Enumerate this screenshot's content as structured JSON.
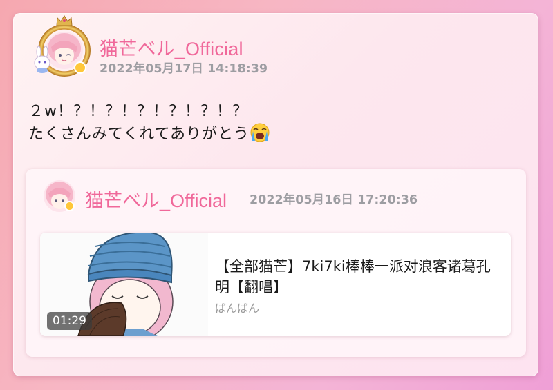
{
  "post": {
    "username": "猫芒ベル_Official",
    "timestamp": "2022年05月17日 14:18:39",
    "text_line1": "２w！？！？！？！？！？！？",
    "text_line2": "たくさんみてくれてありがとう",
    "emoji": "crying-face"
  },
  "repost": {
    "username": "猫芒ベル_Official",
    "timestamp": "2022年05月16日 17:20:36",
    "video": {
      "duration": "01:29",
      "title": "【全部猫芒】7ki7ki棒棒一派对浪客诸葛孔明【翻唱】",
      "author": "ばんばん"
    }
  },
  "colors": {
    "username": "#f0689a",
    "timestamp": "#9d9da2",
    "badge": "#ffc73a",
    "frame_gold": "#d9a441"
  }
}
